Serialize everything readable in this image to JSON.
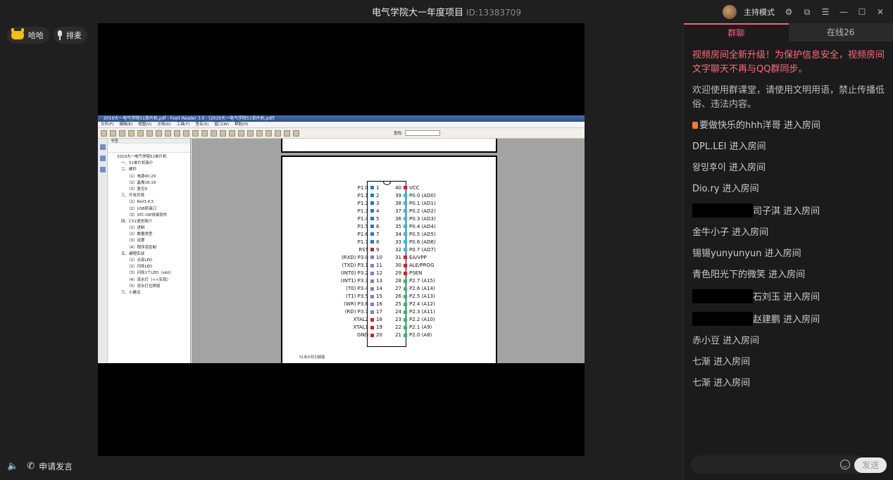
{
  "window": {
    "title": "电气学院大一年度项目",
    "room_id": "ID:13383709",
    "host_mode_label": "主持模式",
    "icons": [
      "gear-icon",
      "popout-icon",
      "menu-icon",
      "minimize-icon",
      "maximize-icon",
      "close-icon"
    ]
  },
  "left": {
    "user_name": "哈哈",
    "queue_label": "排麦",
    "apply_speak_label": "申请发言"
  },
  "screenshare": {
    "app_title": "2019大一电气学院51单片机.pdf - Foxit Reader 3.0 - [2019大一电气学院51单片机.pdf]",
    "menu": [
      "文件(F)",
      "编辑(E)",
      "视图(V)",
      "文档(D)",
      "工具(T)",
      "签名(S)",
      "窗口(W)",
      "帮助(H)"
    ],
    "find_label": "查找:",
    "bookmark_header": "书签",
    "bookmarks": [
      {
        "level": 0,
        "text": "2019大一电气学院51单片机"
      },
      {
        "level": 1,
        "text": "一、51单片机简介"
      },
      {
        "level": 1,
        "text": "二、硬件"
      },
      {
        "level": 2,
        "text": "（1）电源40,20"
      },
      {
        "level": 2,
        "text": "（2）晶振18,19"
      },
      {
        "level": 2,
        "text": "（3）复位9"
      },
      {
        "level": 1,
        "text": "三、开发环境"
      },
      {
        "level": 2,
        "text": "（1）Keil3,4,5"
      },
      {
        "level": 2,
        "text": "（2）USB转串口"
      },
      {
        "level": 2,
        "text": "（3）STC-ISP烧录软件"
      },
      {
        "level": 1,
        "text": "四、C51语言简介"
      },
      {
        "level": 2,
        "text": "（1）进制"
      },
      {
        "level": 2,
        "text": "（2）数据类型"
      },
      {
        "level": 2,
        "text": "（3）运算"
      },
      {
        "level": 2,
        "text": "（4）程序流控制"
      },
      {
        "level": 1,
        "text": "五、编程实战"
      },
      {
        "level": 2,
        "text": "（1）点亮LED"
      },
      {
        "level": 2,
        "text": "（2）闪烁LED"
      },
      {
        "level": 2,
        "text": "（3）闪烁1个LED（sbit）"
      },
      {
        "level": 2,
        "text": "（4）流水灯（<<实现）"
      },
      {
        "level": 2,
        "text": "（5）流水灯位移版"
      },
      {
        "level": 1,
        "text": "六、小建议"
      }
    ],
    "pins_left": [
      {
        "label": "P1.0",
        "num": "1",
        "color": "#1e78d2"
      },
      {
        "label": "P1.1",
        "num": "2",
        "color": "#1e78d2"
      },
      {
        "label": "P1.2",
        "num": "3",
        "color": "#1e78d2"
      },
      {
        "label": "P1.3",
        "num": "4",
        "color": "#1e78d2"
      },
      {
        "label": "P1.4",
        "num": "5",
        "color": "#1e78d2"
      },
      {
        "label": "P1.5",
        "num": "6",
        "color": "#1e78d2"
      },
      {
        "label": "P1.6",
        "num": "7",
        "color": "#1e78d2"
      },
      {
        "label": "P1.7",
        "num": "8",
        "color": "#1e78d2"
      },
      {
        "label": "RST",
        "num": "9",
        "color": "#d42020"
      },
      {
        "label": "(RXD) P3.0",
        "num": "10",
        "color": "#7c7cd8"
      },
      {
        "label": "(TXD) P3.1",
        "num": "11",
        "color": "#7c7cd8"
      },
      {
        "label": "(INT0) P3.2",
        "num": "12",
        "color": "#7c7cd8"
      },
      {
        "label": "(INT1) P3.3",
        "num": "13",
        "color": "#7c7cd8"
      },
      {
        "label": "(T0) P3.4",
        "num": "14",
        "color": "#7c7cd8"
      },
      {
        "label": "(T1) P3.5",
        "num": "15",
        "color": "#7c7cd8"
      },
      {
        "label": "(WR) P3.6",
        "num": "16",
        "color": "#7c7cd8"
      },
      {
        "label": "(RD) P3.7",
        "num": "17",
        "color": "#7c7cd8"
      },
      {
        "label": "XTAL2",
        "num": "18",
        "color": "#d42020"
      },
      {
        "label": "XTAL1",
        "num": "19",
        "color": "#d42020"
      },
      {
        "label": "GND",
        "num": "20",
        "color": "#d42020"
      }
    ],
    "pins_right": [
      {
        "label": "VCC",
        "num": "40",
        "color": "#d42020"
      },
      {
        "label": "P0.0 (AD0)",
        "num": "39",
        "color": "#18c8d8"
      },
      {
        "label": "P0.1 (AD1)",
        "num": "38",
        "color": "#18c8d8"
      },
      {
        "label": "P0.2 (AD2)",
        "num": "37",
        "color": "#18c8d8"
      },
      {
        "label": "P0.3 (AD3)",
        "num": "36",
        "color": "#18c8d8"
      },
      {
        "label": "P0.4 (AD4)",
        "num": "35",
        "color": "#18c8d8"
      },
      {
        "label": "P0.5 (AD5)",
        "num": "34",
        "color": "#18c8d8"
      },
      {
        "label": "P0.6 (AD6)",
        "num": "33",
        "color": "#18c8d8"
      },
      {
        "label": "P0.7 (AD7)",
        "num": "32",
        "color": "#18c8d8"
      },
      {
        "label": "EA/VPP",
        "num": "31",
        "color": "#d42020"
      },
      {
        "label": "ALE/PROG",
        "num": "30",
        "color": "#d42020"
      },
      {
        "label": "PSEN",
        "num": "29",
        "color": "#d42020"
      },
      {
        "label": "P2.7 (A15)",
        "num": "28",
        "color": "#22c06a"
      },
      {
        "label": "P2.6 (A14)",
        "num": "27",
        "color": "#22c06a"
      },
      {
        "label": "P2.5 (A13)",
        "num": "26",
        "color": "#22c06a"
      },
      {
        "label": "P2.4 (A12)",
        "num": "25",
        "color": "#22c06a"
      },
      {
        "label": "P2.3 (A11)",
        "num": "24",
        "color": "#22c06a"
      },
      {
        "label": "P2.2 (A10)",
        "num": "23",
        "color": "#22c06a"
      },
      {
        "label": "P2.1 (A9)",
        "num": "22",
        "color": "#22c06a"
      },
      {
        "label": "P2.0 (A8)",
        "num": "21",
        "color": "#22c06a"
      }
    ],
    "caption": "51单片机引脚图"
  },
  "chat": {
    "tab_chat": "群聊",
    "tab_online": "在线26",
    "notice": "视频房间全新升级！为保护信息安全，视频房间文字聊天不再与QQ群同步。",
    "welcome": "欢迎使用群课堂，请使用文明用语，禁止传播低俗、违法内容。",
    "joins": [
      {
        "name": "要做快乐的hhh洋哥",
        "suffix": " 进入房间",
        "badge": true,
        "redacted": false
      },
      {
        "name": "DPL.LEI",
        "suffix": " 进入房间",
        "badge": false,
        "redacted": false
      },
      {
        "name": "왕밍후이",
        "suffix": " 进入房间",
        "badge": false,
        "redacted": false
      },
      {
        "name": "Dio.ry",
        "suffix": " 进入房间",
        "badge": false,
        "redacted": false
      },
      {
        "name": "司子淇",
        "suffix": " 进入房间",
        "badge": false,
        "redacted": true
      },
      {
        "name": "金牛小子",
        "suffix": " 进入房间",
        "badge": false,
        "redacted": false
      },
      {
        "name": "锡锡yunyunyun",
        "suffix": " 进入房间",
        "badge": false,
        "redacted": false
      },
      {
        "name": "青色阳光下的微笑",
        "suffix": " 进入房间",
        "badge": false,
        "redacted": false
      },
      {
        "name": "石刘玉",
        "suffix": " 进入房间",
        "badge": false,
        "redacted": true
      },
      {
        "name": "赵建鹏",
        "suffix": " 进入房间",
        "badge": false,
        "redacted": true
      },
      {
        "name": "赤小豆",
        "suffix": " 进入房间",
        "badge": false,
        "redacted": false
      },
      {
        "name": "七渐",
        "suffix": " 进入房间",
        "badge": false,
        "redacted": false
      },
      {
        "name": "七渐",
        "suffix": " 进入房间",
        "badge": false,
        "redacted": false
      }
    ],
    "send_label": "发送",
    "input_placeholder": ""
  }
}
